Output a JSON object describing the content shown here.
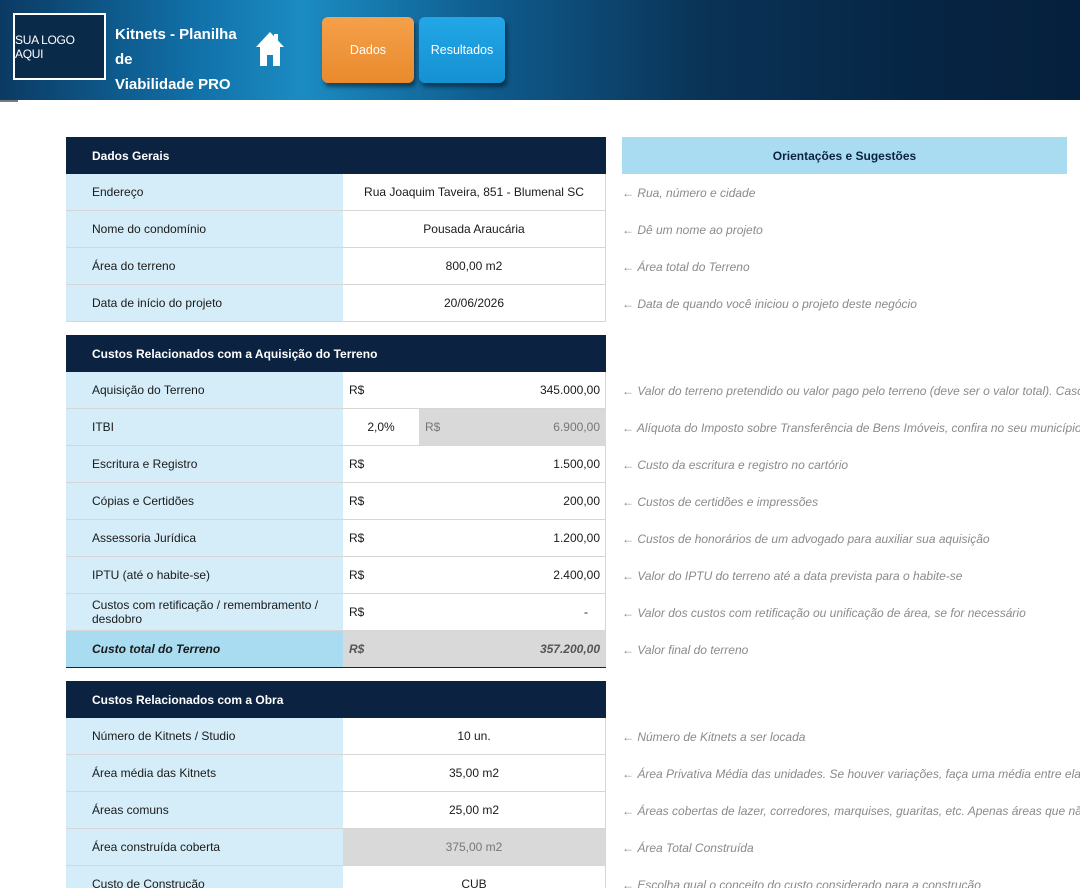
{
  "header": {
    "logo_text": "SUA LOGO AQUI",
    "title_line1": "Kitnets - Planilha de",
    "title_line2": "Viabilidade PRO",
    "home_icon": "home-icon",
    "nav": {
      "dados_label": "Dados",
      "resultados_label": "Resultados",
      "dados_color": "#e98a2d",
      "resultados_color": "#1591d2"
    }
  },
  "orientacoes": {
    "title": "Orientações e Sugestões"
  },
  "dados_gerais": {
    "title": "Dados Gerais",
    "rows": [
      {
        "label": "Endereço",
        "value": "Rua Joaquim Taveira, 851 - Blumenal SC",
        "hint": "← Rua, número e cidade"
      },
      {
        "label": "Nome do condomínio",
        "value": "Pousada Araucária",
        "hint": "← Dê um nome ao projeto"
      },
      {
        "label": "Área do terreno",
        "value": "800,00 m2",
        "hint": "← Área total do Terreno"
      },
      {
        "label": "Data de início do projeto",
        "value": "20/06/2026",
        "hint": "← Data de quando você iniciou o projeto deste negócio"
      }
    ]
  },
  "terreno": {
    "title": "Custos Relacionados com a Aquisição do Terreno",
    "currency": "R$",
    "aquisicao": {
      "label": "Aquisição do Terreno",
      "amount": "345.000,00",
      "hint": "← Valor do terreno pretendido ou valor pago pelo terreno (deve ser o valor total). Caso tenha o imóvel h"
    },
    "itbi": {
      "label": "ITBI",
      "percent": "2,0%",
      "amount": "6.900,00",
      "hint": "← Alíquota do Imposto sobre Transferência de Bens Imóveis, confira no seu município o valor"
    },
    "escritura": {
      "label": "Escritura e Registro",
      "amount": "1.500,00",
      "hint": "← Custo da escritura e registro no cartório"
    },
    "copias": {
      "label": "Cópias e Certidões",
      "amount": "200,00",
      "hint": "← Custos de certidões e impressões"
    },
    "assessoria": {
      "label": "Assessoria Jurídica",
      "amount": "1.200,00",
      "hint": "← Custos de honorários de um advogado para auxiliar sua aquisição"
    },
    "iptu": {
      "label": "IPTU (até o habite-se)",
      "amount": "2.400,00",
      "hint": "← Valor do IPTU do terreno até a data prevista para o habite-se"
    },
    "retificacao": {
      "label": "Custos com retificação / remembramento / desdobro",
      "amount": "-",
      "hint": "← Valor dos custos com retificação ou unificação de área, se for necessário"
    },
    "total": {
      "label": "Custo total do Terreno",
      "amount": "357.200,00",
      "hint": "← Valor final do terreno"
    }
  },
  "obra": {
    "title": "Custos Relacionados com a Obra",
    "rows": [
      {
        "label": "Número de Kitnets / Studio",
        "value": "10 un.",
        "hint": "← Número de Kitnets a ser locada"
      },
      {
        "label": "Área média das Kitnets",
        "value": "35,00 m2",
        "hint": "← Área Privativa Média das unidades. Se houver variações, faça uma média entre elas"
      },
      {
        "label": "Áreas comuns",
        "value": "25,00 m2",
        "hint": "← Áreas cobertas de lazer, corredores, marquises, guaritas, etc. Apenas áreas que não são das unidades"
      },
      {
        "label": "Área construída coberta",
        "value": "375,00 m2",
        "hint": "← Área Total Construída"
      },
      {
        "label": "Custo de Construção",
        "value": "CUB",
        "hint": "← Escolha qual o conceito do custo considerado para a construção"
      }
    ]
  }
}
